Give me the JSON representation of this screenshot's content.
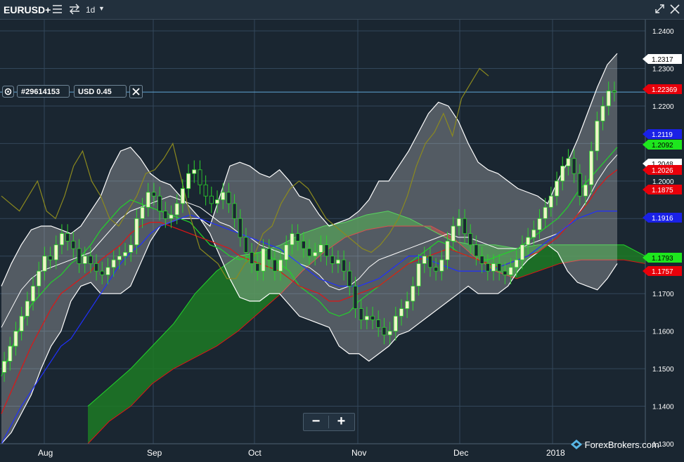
{
  "toolbar": {
    "symbol": "EURUSD+",
    "timeframe": "1d",
    "icons": [
      "hamburger-icon",
      "swap-arrows-icon",
      "caret-down-icon",
      "expand-icon",
      "close-icon"
    ]
  },
  "order_panel": {
    "order_id": "#29614153",
    "pnl": "USD 0.45",
    "icons": [
      "settings-gear-icon",
      "close-box-icon"
    ]
  },
  "zoom": {
    "minus": "−",
    "plus": "+"
  },
  "watermark": "ForexBrokers.com",
  "chart_data": {
    "type": "candlestick",
    "symbol": "EURUSD+",
    "timeframe": "1d",
    "y_axis": {
      "ylim": [
        1.13,
        1.243
      ],
      "ticks": [
        "1.2400",
        "1.2300",
        "1.2200",
        "1.2100",
        "1.2000",
        "1.1900",
        "1.1800",
        "1.1700",
        "1.1600",
        "1.1500",
        "1.1400",
        "1.1300"
      ]
    },
    "x_axis": {
      "ticks": [
        "Aug",
        "Sep",
        "Oct",
        "Nov",
        "Dec",
        "2018"
      ]
    },
    "price_tags": [
      {
        "label": "1.2317",
        "bg": "#ffffff",
        "fg": "#000000"
      },
      {
        "label": "1.22369",
        "bg": "#e8000a",
        "fg": "#ffffff"
      },
      {
        "label": "1.2119",
        "bg": "#1a21e6",
        "fg": "#ffffff"
      },
      {
        "label": "1.2092",
        "bg": "#1ee61e",
        "fg": "#000000"
      },
      {
        "label": "1.2048",
        "bg": "#ffffff",
        "fg": "#000000"
      },
      {
        "label": "1.2026",
        "bg": "#e8000a",
        "fg": "#ffffff"
      },
      {
        "label": "1.1875",
        "bg": "#e8000a",
        "fg": "#ffffff"
      },
      {
        "label": "1.1916",
        "bg": "#1a21e6",
        "fg": "#ffffff"
      },
      {
        "label": "1.1793",
        "bg": "#1ee61e",
        "fg": "#000000"
      },
      {
        "label": "1.1757",
        "bg": "#e8000a",
        "fg": "#ffffff"
      }
    ],
    "price_line": 1.2237,
    "closes": [
      1.152,
      1.156,
      1.16,
      1.164,
      1.168,
      1.172,
      1.176,
      1.18,
      1.179,
      1.183,
      1.186,
      1.184,
      1.182,
      1.178,
      1.18,
      1.178,
      1.176,
      1.175,
      1.177,
      1.179,
      1.18,
      1.181,
      1.183,
      1.19,
      1.193,
      1.197,
      1.196,
      1.192,
      1.19,
      1.191,
      1.194,
      1.198,
      1.202,
      1.203,
      1.199,
      1.196,
      1.194,
      1.195,
      1.197,
      1.194,
      1.19,
      1.185,
      1.181,
      1.178,
      1.176,
      1.182,
      1.179,
      1.176,
      1.179,
      1.183,
      1.186,
      1.184,
      1.182,
      1.18,
      1.181,
      1.183,
      1.18,
      1.178,
      1.179,
      1.176,
      1.172,
      1.166,
      1.163,
      1.164,
      1.163,
      1.161,
      1.159,
      1.16,
      1.164,
      1.166,
      1.168,
      1.172,
      1.178,
      1.18,
      1.177,
      1.176,
      1.179,
      1.184,
      1.188,
      1.19,
      1.186,
      1.183,
      1.18,
      1.178,
      1.176,
      1.178,
      1.176,
      1.175,
      1.177,
      1.179,
      1.183,
      1.185,
      1.187,
      1.19,
      1.193,
      1.196,
      1.2,
      1.204,
      1.206,
      1.202,
      1.196,
      1.199,
      1.208,
      1.216,
      1.22,
      1.224,
      1.2237
    ],
    "bb_upper": [
      1.172,
      1.178,
      1.183,
      1.187,
      1.188,
      1.188,
      1.187,
      1.186,
      1.188,
      1.192,
      1.196,
      1.203,
      1.208,
      1.209,
      1.206,
      1.202,
      1.2,
      1.199,
      1.196,
      1.193,
      1.19,
      1.188,
      1.196,
      1.204,
      1.205,
      1.204,
      1.202,
      1.201,
      1.203,
      1.2,
      1.196,
      1.195,
      1.191,
      1.188,
      1.189,
      1.19,
      1.192,
      1.195,
      1.2,
      1.2,
      1.204,
      1.208,
      1.213,
      1.218,
      1.221,
      1.22,
      1.216,
      1.21,
      1.205,
      1.203,
      1.202,
      1.2,
      1.198,
      1.197,
      1.196,
      1.194,
      1.2,
      1.205,
      1.211,
      1.218,
      1.225,
      1.231,
      1.234
    ],
    "bb_middle": [
      1.161,
      1.166,
      1.171,
      1.174,
      1.176,
      1.177,
      1.178,
      1.179,
      1.18,
      1.181,
      1.184,
      1.187,
      1.19,
      1.192,
      1.193,
      1.194,
      1.195,
      1.196,
      1.195,
      1.194,
      1.193,
      1.191,
      1.189,
      1.188,
      1.186,
      1.185,
      1.183,
      1.182,
      1.181,
      1.18,
      1.178,
      1.177,
      1.175,
      1.172,
      1.171,
      1.172,
      1.174,
      1.177,
      1.179,
      1.18,
      1.181,
      1.182,
      1.183,
      1.184,
      1.185,
      1.186,
      1.185,
      1.185,
      1.184,
      1.183,
      1.182,
      1.182,
      1.182,
      1.183,
      1.184,
      1.185,
      1.186,
      1.188,
      1.191,
      1.195,
      1.2,
      1.204,
      1.207
    ],
    "bb_lower": [
      1.13,
      1.133,
      1.138,
      1.143,
      1.15,
      1.156,
      1.16,
      1.168,
      1.172,
      1.173,
      1.17,
      1.17,
      1.17,
      1.172,
      1.178,
      1.184,
      1.188,
      1.189,
      1.19,
      1.19,
      1.19,
      1.186,
      1.18,
      1.174,
      1.169,
      1.168,
      1.168,
      1.17,
      1.17,
      1.167,
      1.164,
      1.163,
      1.162,
      1.161,
      1.156,
      1.154,
      1.154,
      1.152,
      1.154,
      1.156,
      1.159,
      1.16,
      1.162,
      1.164,
      1.166,
      1.168,
      1.17,
      1.172,
      1.17,
      1.17,
      1.17,
      1.172,
      1.176,
      1.179,
      1.181,
      1.183,
      1.181,
      1.176,
      1.173,
      1.172,
      1.171,
      1.174,
      1.178
    ],
    "ma_green": [
      1.148,
      1.155,
      1.162,
      1.167,
      1.17,
      1.173,
      1.175,
      1.178,
      1.18,
      1.183,
      1.187,
      1.19,
      1.193,
      1.195,
      1.194,
      1.193,
      1.192,
      1.191,
      1.19,
      1.189,
      1.186,
      1.183,
      1.182,
      1.18,
      1.179,
      1.18,
      1.181,
      1.18,
      1.178,
      1.176,
      1.172,
      1.17,
      1.168,
      1.165,
      1.164,
      1.165,
      1.168,
      1.17,
      1.172,
      1.174,
      1.176,
      1.178,
      1.18,
      1.182,
      1.184,
      1.183,
      1.181,
      1.18,
      1.179,
      1.179,
      1.18,
      1.181,
      1.182,
      1.184,
      1.186,
      1.188,
      1.19,
      1.193,
      1.197,
      1.2,
      1.203,
      1.206,
      1.209
    ],
    "ma_red": [
      1.138,
      1.144,
      1.15,
      1.156,
      1.161,
      1.166,
      1.17,
      1.172,
      1.174,
      1.176,
      1.179,
      1.181,
      1.183,
      1.186,
      1.188,
      1.189,
      1.189,
      1.188,
      1.187,
      1.186,
      1.185,
      1.184,
      1.183,
      1.182,
      1.18,
      1.179,
      1.178,
      1.177,
      1.176,
      1.174,
      1.172,
      1.171,
      1.17,
      1.168,
      1.168,
      1.169,
      1.17,
      1.171,
      1.172,
      1.174,
      1.176,
      1.178,
      1.179,
      1.18,
      1.181,
      1.182,
      1.181,
      1.18,
      1.179,
      1.178,
      1.177,
      1.178,
      1.179,
      1.18,
      1.181,
      1.183,
      1.185,
      1.188,
      1.191,
      1.194,
      1.198,
      1.201,
      1.203
    ],
    "ma_blue": [
      1.13,
      1.135,
      1.14,
      1.144,
      1.148,
      1.152,
      1.156,
      1.158,
      1.162,
      1.166,
      1.17,
      1.174,
      1.178,
      1.181,
      1.183,
      1.186,
      1.188,
      1.189,
      1.19,
      1.191,
      1.19,
      1.189,
      1.188,
      1.187,
      1.186,
      1.185,
      1.184,
      1.183,
      1.182,
      1.18,
      1.178,
      1.176,
      1.174,
      1.173,
      1.172,
      1.172,
      1.172,
      1.173,
      1.174,
      1.176,
      1.178,
      1.18,
      1.18,
      1.179,
      1.178,
      1.177,
      1.176,
      1.176,
      1.176,
      1.176,
      1.177,
      1.178,
      1.179,
      1.18,
      1.182,
      1.184,
      1.186,
      1.188,
      1.19,
      1.191,
      1.192,
      1.192,
      1.192
    ],
    "chikou": [
      1.196,
      1.194,
      1.192,
      1.196,
      1.2,
      1.192,
      1.19,
      1.196,
      1.204,
      1.208,
      1.2,
      1.196,
      1.19,
      1.188,
      1.192,
      1.196,
      1.202,
      1.203,
      1.206,
      1.21,
      1.2,
      1.19,
      1.182,
      1.18,
      1.178,
      1.174,
      1.174,
      1.178,
      1.18,
      1.186,
      1.188,
      1.194,
      1.198,
      1.2,
      1.198,
      1.194,
      1.19,
      1.188,
      1.186,
      1.184,
      1.182,
      1.181,
      1.183,
      1.186,
      1.19,
      1.196,
      1.204,
      1.21,
      1.213,
      1.218,
      1.212,
      1.222,
      1.226,
      1.23,
      1.228
    ],
    "cloud_a": [
      1.14,
      1.145,
      1.15,
      1.156,
      1.162,
      1.17,
      1.176,
      1.18,
      1.181,
      1.183,
      1.186,
      1.188,
      1.189,
      1.191,
      1.192,
      1.19,
      1.187,
      1.184,
      1.183,
      1.183,
      1.182,
      1.183,
      1.183,
      1.183,
      1.183,
      1.183,
      1.18
    ],
    "cloud_b": [
      1.13,
      1.136,
      1.14,
      1.146,
      1.15,
      1.153,
      1.156,
      1.16,
      1.165,
      1.17,
      1.176,
      1.181,
      1.185,
      1.187,
      1.188,
      1.188,
      1.188,
      1.185,
      1.18,
      1.176,
      1.174,
      1.176,
      1.178,
      1.179,
      1.179,
      1.179,
      1.178
    ]
  }
}
